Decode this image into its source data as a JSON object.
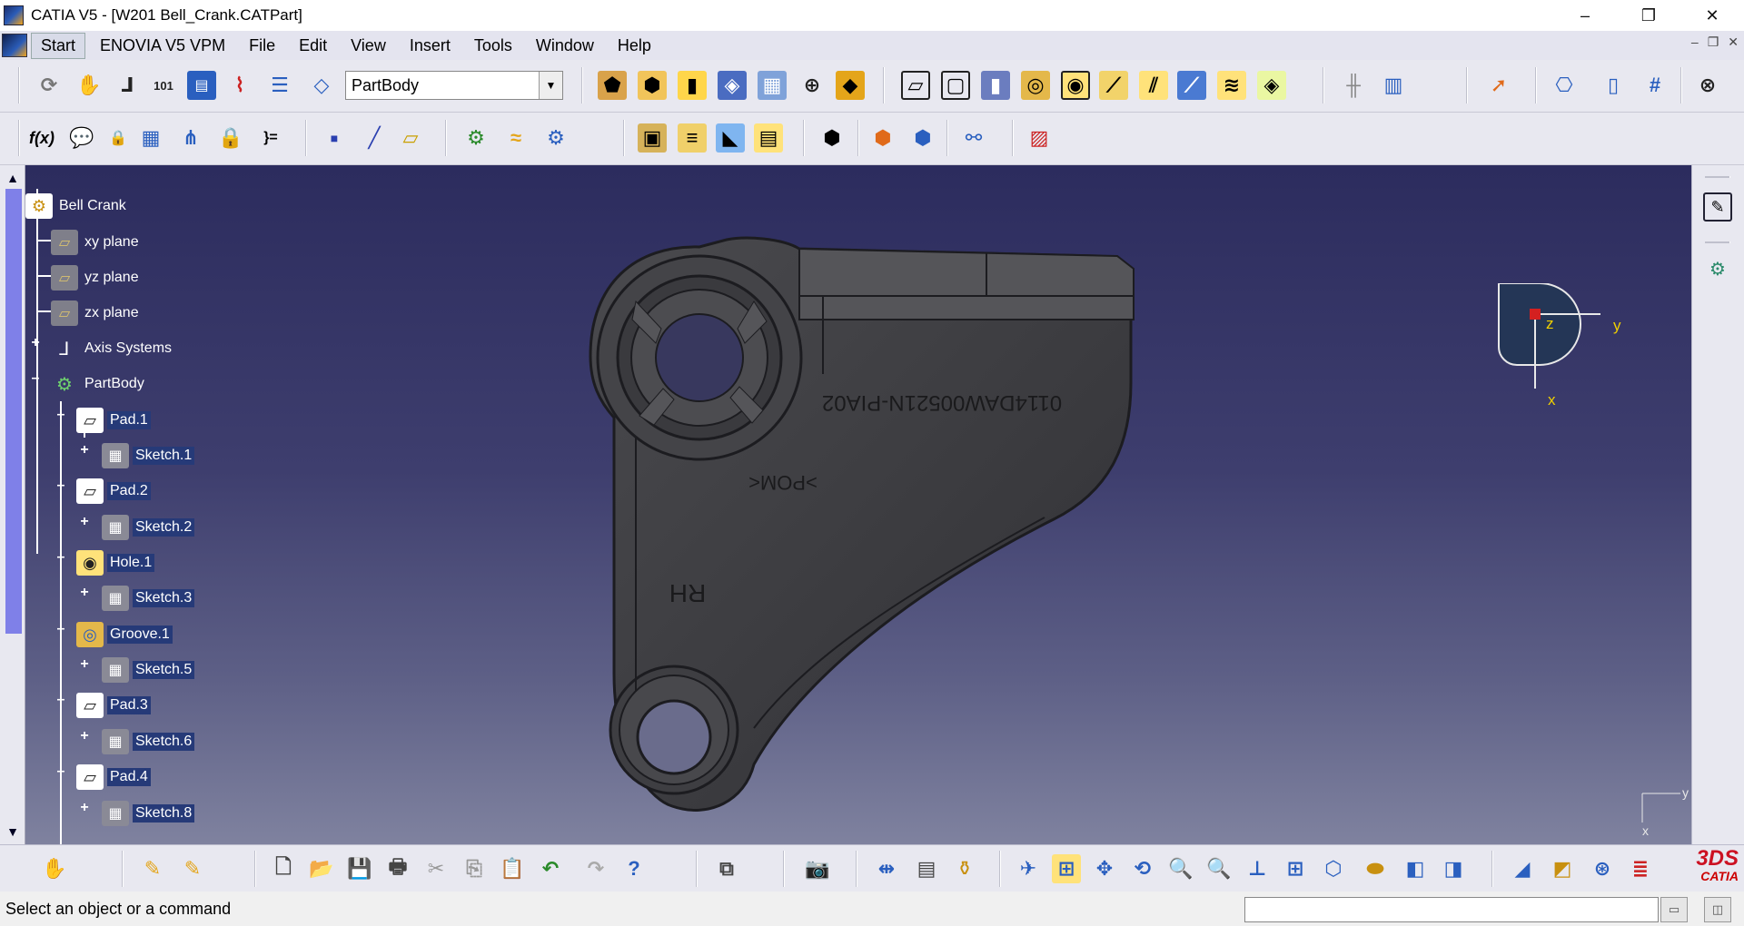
{
  "window": {
    "title": "CATIA V5 - [W201 Bell_Crank.CATPart]",
    "buttons": [
      "–",
      "❐",
      "✕"
    ]
  },
  "menu": {
    "items": [
      "Start",
      "ENOVIA V5 VPM",
      "File",
      "Edit",
      "View",
      "Insert",
      "Tools",
      "Window",
      "Help"
    ],
    "mdi_buttons": [
      "–",
      "❐",
      "✕"
    ]
  },
  "toolbar": {
    "workbench_value": "PartBody"
  },
  "tree": {
    "root": "Bell Crank",
    "nodes": [
      {
        "label": "xy plane"
      },
      {
        "label": "yz plane"
      },
      {
        "label": "zx plane"
      },
      {
        "label": "Axis Systems"
      },
      {
        "label": "PartBody"
      },
      {
        "label": "Pad.1"
      },
      {
        "label": "Sketch.1"
      },
      {
        "label": "Pad.2"
      },
      {
        "label": "Sketch.2"
      },
      {
        "label": "Hole.1"
      },
      {
        "label": "Sketch.3"
      },
      {
        "label": "Groove.1"
      },
      {
        "label": "Sketch.5"
      },
      {
        "label": "Pad.3"
      },
      {
        "label": "Sketch.6"
      },
      {
        "label": "Pad.4"
      },
      {
        "label": "Sketch.8"
      }
    ]
  },
  "part": {
    "engraving_id": "0114DAW00521N-PIA02",
    "engraving_material": ">POM<",
    "engraving_side": "RH"
  },
  "compass": {
    "z": "z",
    "y": "y",
    "x": "x"
  },
  "mini_axis": {
    "y": "y",
    "x": "x"
  },
  "status": {
    "text": "Select an object or a command"
  },
  "branding": {
    "logo_text": "CATIA",
    "logo_mark": "3DS"
  },
  "colors": {
    "viewport_top": "#2c2c5e",
    "viewport_bottom": "#7f829f",
    "part": "#3c3c40",
    "selection": "#263a78",
    "compass_yellow": "#f0d000"
  }
}
